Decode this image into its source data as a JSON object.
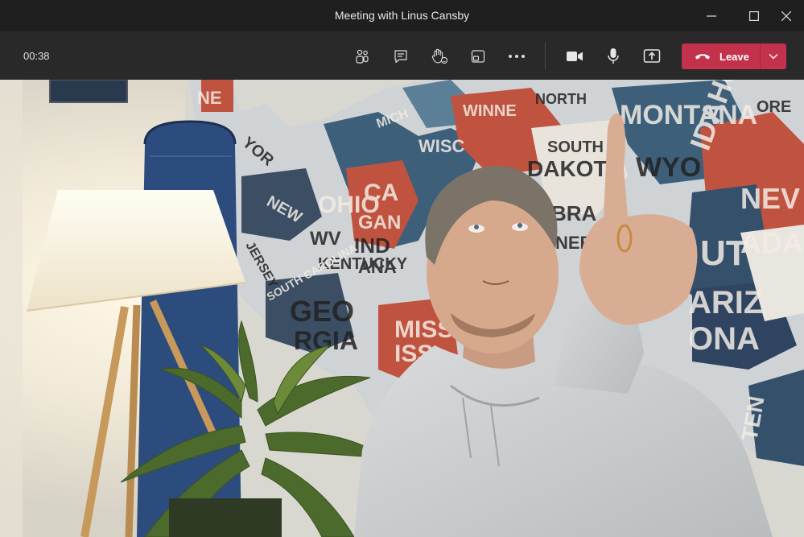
{
  "window": {
    "title": "Meeting with Linus Cansby"
  },
  "toolbar": {
    "timer": "00:38",
    "leave_label": "Leave"
  },
  "icons": {
    "participants": "people-icon",
    "chat": "chat-icon",
    "reactions": "raise-hand-icon",
    "rooms": "breakout-rooms-icon",
    "more": "more-actions-icon",
    "camera": "camera-icon",
    "mic": "microphone-icon",
    "share": "share-screen-icon",
    "leave": "phone-hangup-icon"
  },
  "colors": {
    "leave": "#c4314b",
    "toolbar": "#292929",
    "titlebar": "#1f1f1f"
  },
  "wall_map_words": [
    "NE",
    "YOR",
    "WISC",
    "MICH",
    "CA",
    "GAN",
    "OHIO",
    "IND",
    "ANA",
    "WV",
    "KENTUCKY",
    "WINNE",
    "SOUTH",
    "DAKOTA",
    "NORTH",
    "MONTANA",
    "IDAHO",
    "WYO",
    "ORE",
    "BRA",
    "GEO",
    "RGIA",
    "MISS",
    "ISS",
    "ARIZ",
    "ONA",
    "NEV",
    "ADA",
    "UT",
    "TEN",
    "NEBRA",
    "SOUTH CAROLINA",
    "NEW",
    "JERSEY"
  ]
}
